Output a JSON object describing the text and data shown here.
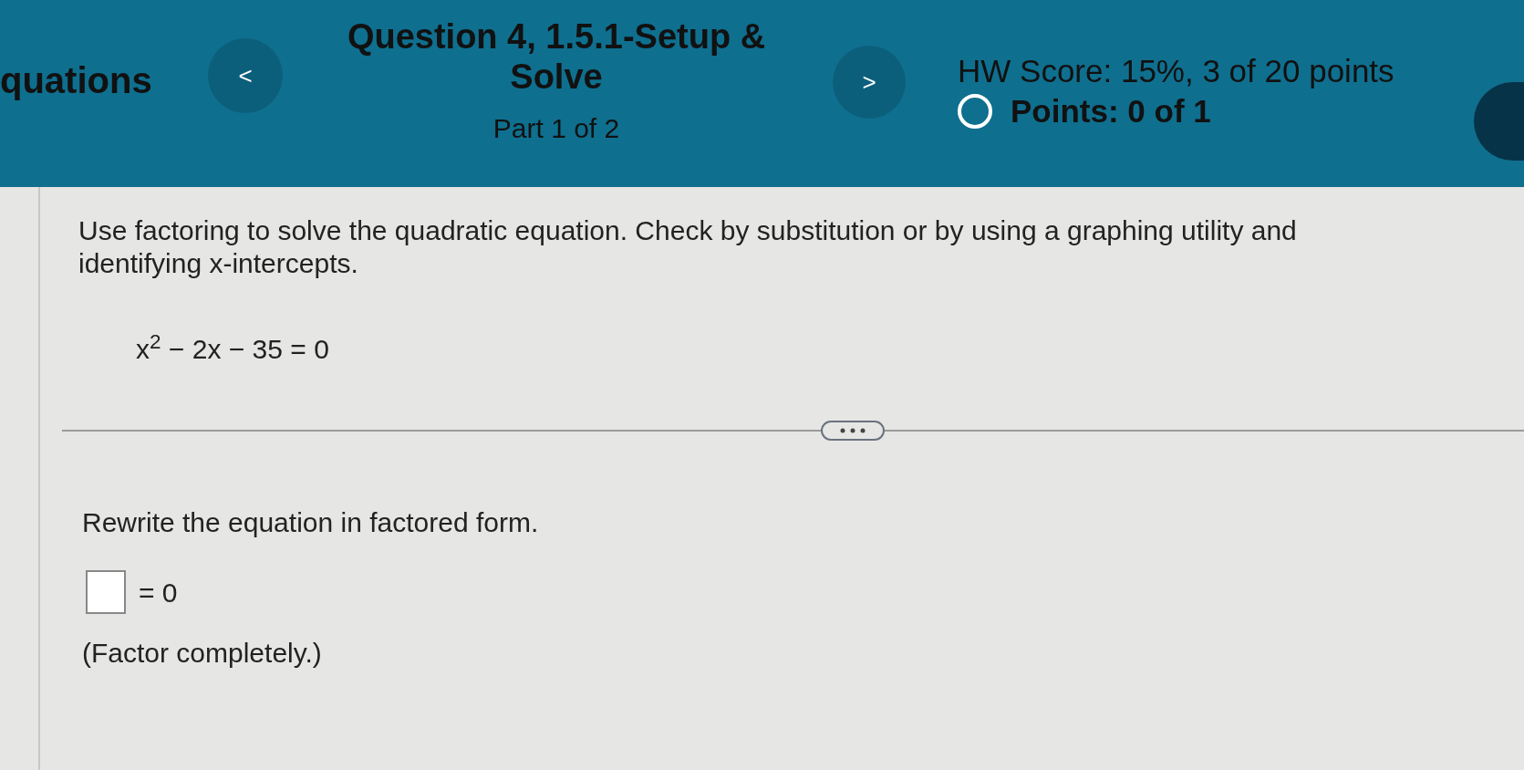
{
  "header": {
    "section_title": "quations",
    "prev_button": "<",
    "question_title": "Question 4, 1.5.1-Setup & Solve",
    "part": "Part 1 of 2",
    "next_button": ">",
    "hw_score": "HW Score: 15%, 3 of 20 points",
    "points": "Points: 0 of 1"
  },
  "question": {
    "instruction": "Use factoring to solve the quadratic equation.  Check by substitution or by using a graphing utility and identifying x-intercepts.",
    "equation": "x$^{2}$ − 2x − 35 = 0"
  },
  "answer": {
    "prompt": "Rewrite the equation in factored form.",
    "equals": "= 0",
    "hint": "(Factor completely.)"
  }
}
